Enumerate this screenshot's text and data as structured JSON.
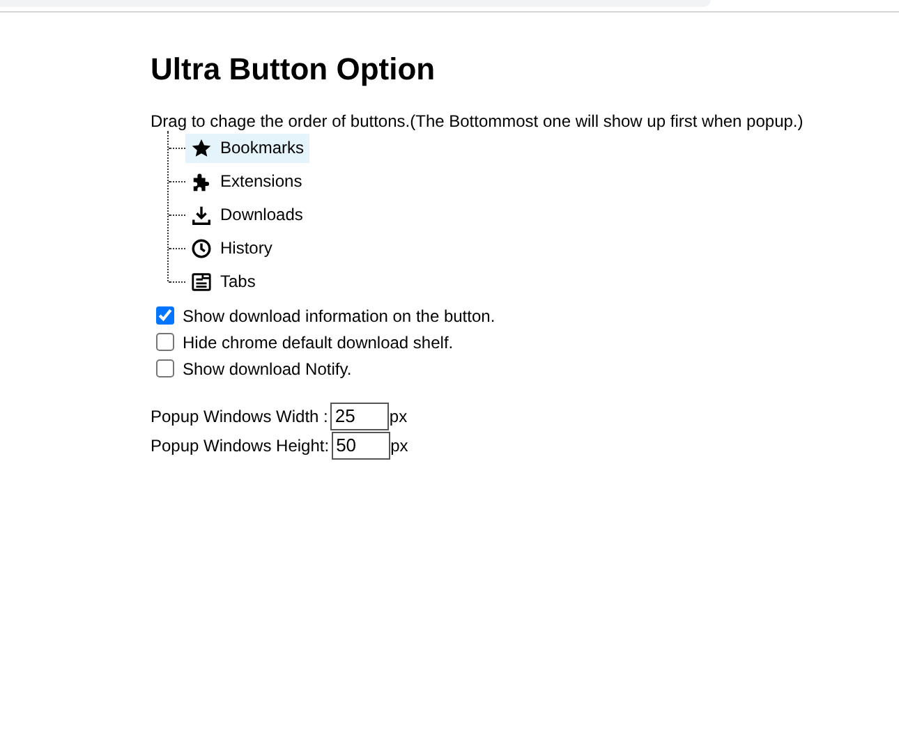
{
  "title": "Ultra Button Option",
  "instruction": "Drag to chage the order of buttons.(The Bottommost one will show up first when popup.)",
  "buttons": [
    {
      "label": "Bookmarks",
      "kind": "star",
      "selected": true
    },
    {
      "label": "Extensions",
      "kind": "puzzle",
      "selected": false
    },
    {
      "label": "Downloads",
      "kind": "download",
      "selected": false
    },
    {
      "label": "History",
      "kind": "clock",
      "selected": false
    },
    {
      "label": "Tabs",
      "kind": "tabs",
      "selected": false
    }
  ],
  "options": [
    {
      "label": "Show download information on the button.",
      "checked": true
    },
    {
      "label": "Hide chrome default download shelf.",
      "checked": false
    },
    {
      "label": "Show download Notify.",
      "checked": false
    }
  ],
  "sizes": [
    {
      "label": "Popup Windows Width :",
      "value": "25",
      "unit": "px"
    },
    {
      "label": "Popup Windows Height:",
      "value": "50",
      "unit": "px"
    }
  ]
}
